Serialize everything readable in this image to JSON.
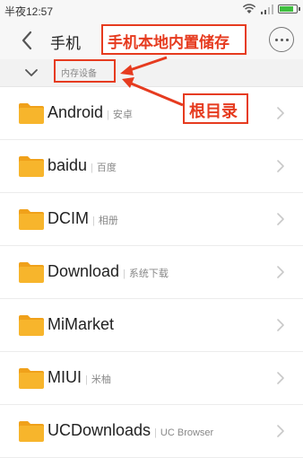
{
  "status_bar": {
    "time": "半夜12:57",
    "battery_level": 0.9
  },
  "header": {
    "title": "手机"
  },
  "callouts": {
    "storage": "手机本地内置储存",
    "root": "根目录"
  },
  "breadcrumb": {
    "current": "内存设备"
  },
  "files": [
    {
      "name": "Android",
      "subtitle": "安卓"
    },
    {
      "name": "baidu",
      "subtitle": "百度"
    },
    {
      "name": "DCIM",
      "subtitle": "相册"
    },
    {
      "name": "Download",
      "subtitle": "系统下载"
    },
    {
      "name": "MiMarket",
      "subtitle": ""
    },
    {
      "name": "MIUI",
      "subtitle": "米柚"
    },
    {
      "name": "UCDownloads",
      "subtitle": "UC Browser"
    }
  ],
  "colors": {
    "folder": "#f7b52c",
    "folder_tab": "#f0a11a",
    "annotation": "#e63b1f"
  }
}
